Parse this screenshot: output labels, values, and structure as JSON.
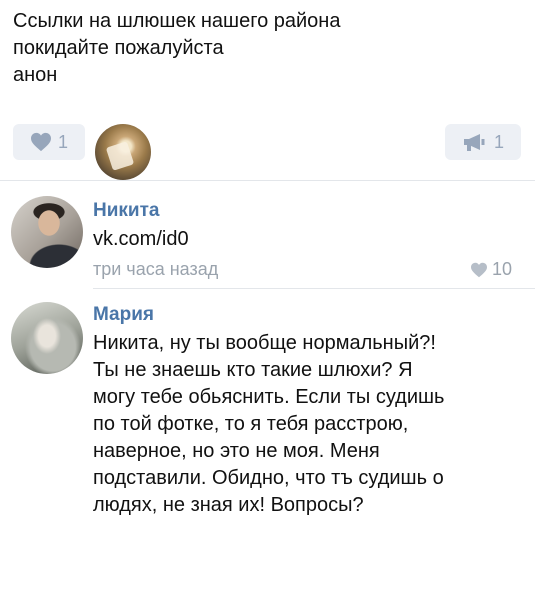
{
  "post": {
    "lines": [
      "Ссылки на шлюшек нашего района",
      "покидайте пожалуйста",
      "анон"
    ],
    "like_count": "1",
    "share_count": "1"
  },
  "comments": [
    {
      "author": "Никита",
      "text_lines": [
        "vk.com/id0"
      ],
      "time": "три часа назад",
      "likes": "10"
    },
    {
      "author": "Мария",
      "text_lines": [
        "Никита, ну ты вообще нормальный?!",
        "Ты не знаешь кто такие шлюхи? Я",
        "могу тебе обьяснить. Если ты судишь",
        "по той фотке, то я тебя расстрою,",
        "наверное, но это не моя. Меня",
        "подставили. Обидно, что тъ судишь о",
        "людях, не зная их! Вопросы?"
      ]
    }
  ],
  "icons": {
    "like": "heart-icon",
    "share": "megaphone-icon"
  },
  "colors": {
    "link_blue": "#4a76a8",
    "button_bg": "#edf0f5",
    "icon_gray": "#97a6bb"
  }
}
